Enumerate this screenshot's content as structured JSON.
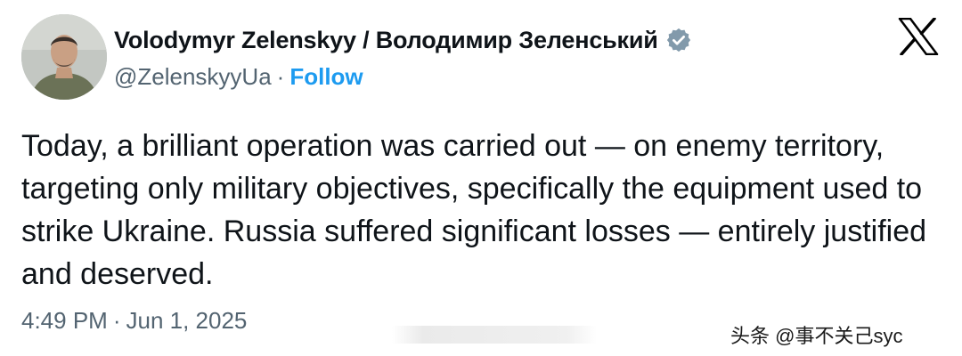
{
  "author": {
    "display_name": "Volodymyr Zelenskyy / Володимир Зеленський",
    "handle": "@ZelenskyyUa",
    "separator": "·",
    "follow_label": "Follow",
    "avatar_icon": "user-avatar-photo",
    "verified_icon": "verified-badge-icon",
    "verified_color": "#829aab"
  },
  "platform": {
    "logo_icon": "x-logo-icon"
  },
  "tweet": {
    "text": "Today, a brilliant operation was carried out — on enemy territory, targeting only military objectives, specifically the equipment used to strike Ukraine. Russia suffered significant losses — entirely justified and deserved.",
    "time": "4:49 PM",
    "separator": "·",
    "date": "Jun 1, 2025"
  },
  "watermark": {
    "text": "头条 @事不关己syc"
  },
  "colors": {
    "text": "#0f1419",
    "secondary": "#536471",
    "link": "#1d9bf0",
    "background": "#ffffff"
  }
}
